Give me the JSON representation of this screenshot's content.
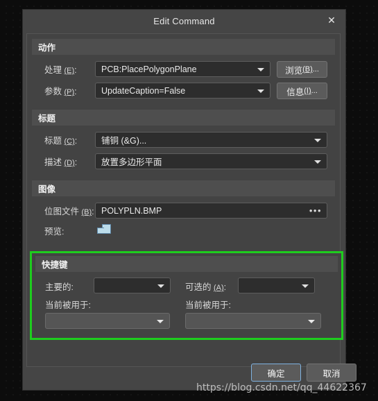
{
  "window": {
    "title": "Edit Command",
    "close_icon": "close-icon"
  },
  "sections": {
    "action": {
      "header": "动作",
      "handler": {
        "label_text": "处理 ",
        "label_mnemonic": "(E)",
        "label_colon": ":",
        "value": "PCB:PlacePolygonPlane"
      },
      "params": {
        "label_text": "参数 ",
        "label_mnemonic": "(P)",
        "label_colon": ":",
        "value": "UpdateCaption=False"
      },
      "browse_button": {
        "text": "浏览 ",
        "mnemonic": "(B)",
        "suffix": "..."
      },
      "info_button": {
        "text": "信息 ",
        "mnemonic": "(I)",
        "suffix": "..."
      }
    },
    "caption": {
      "header": "标题",
      "caption": {
        "label_text": "标题 ",
        "label_mnemonic": "(C)",
        "label_colon": ":",
        "value": "铺铜 (&G)..."
      },
      "description": {
        "label_text": "描述 ",
        "label_mnemonic": "(D)",
        "label_colon": ":",
        "value": "放置多边形平面"
      }
    },
    "image": {
      "header": "图像",
      "bitmap_file": {
        "label_text": "位图文件 ",
        "label_mnemonic": "(B)",
        "label_colon": ":",
        "value": "POLYPLN.BMP",
        "ellipsis": "•••"
      },
      "preview": {
        "label": "预览:",
        "icon": "polygon-plane-icon"
      }
    },
    "shortcut": {
      "header": "快捷键",
      "highlight_color": "#1ecd1e",
      "primary": {
        "label": "主要的:",
        "value": ""
      },
      "alternate": {
        "label_text": "可选的 ",
        "label_mnemonic": "(A)",
        "label_colon": ":",
        "value": ""
      },
      "currently_used_by_left": {
        "label": "当前被用于:",
        "value": ""
      },
      "currently_used_by_right": {
        "label": "当前被用于:",
        "value": ""
      }
    }
  },
  "footer": {
    "ok_label": "确定",
    "cancel_label": "取消"
  },
  "watermark": {
    "text": "https://blog.csdn.net/qq_44622367"
  }
}
